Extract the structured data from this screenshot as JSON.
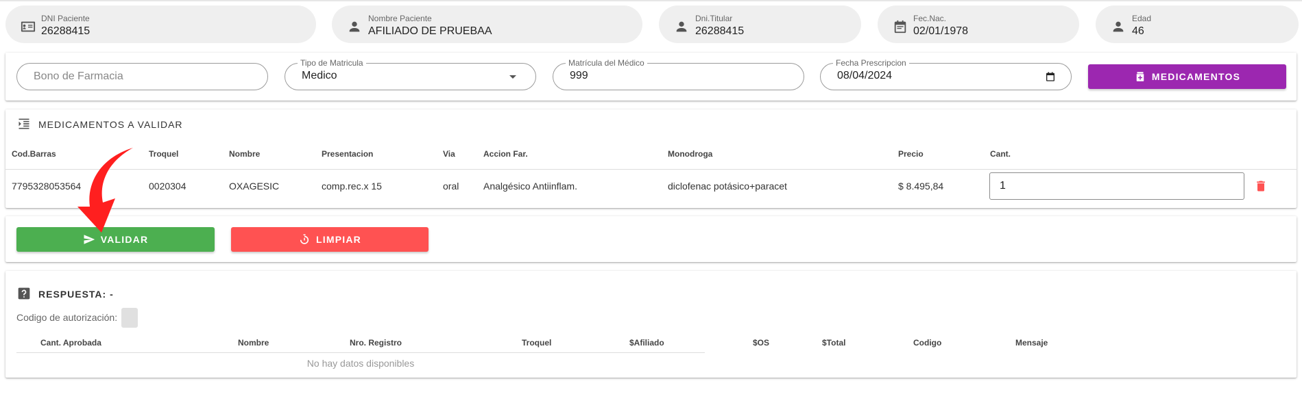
{
  "patient": {
    "dni": {
      "label": "DNI Paciente",
      "value": "26288415",
      "icon": "id-card-icon"
    },
    "nombre": {
      "label": "Nombre Paciente",
      "value": "AFILIADO DE PRUEBAA",
      "icon": "person-icon"
    },
    "titular": {
      "label": "Dni.Titular",
      "value": "26288415",
      "icon": "person-icon"
    },
    "fecnac": {
      "label": "Fec.Nac.",
      "value": "02/01/1978",
      "icon": "calendar-icon"
    },
    "edad": {
      "label": "Edad",
      "value": "46",
      "icon": "person-icon"
    }
  },
  "form": {
    "bono_placeholder": "Bono de Farmacia",
    "tipo_label": "Tipo de Matricula",
    "tipo_value": "Medico",
    "matricula_label": "Matrícula del Médico",
    "matricula_value": "999",
    "fecha_label": "Fecha Prescripcion",
    "fecha_value": "08/04/2024",
    "medicamentos_button": "MEDICAMENTOS"
  },
  "meds": {
    "title": "MEDICAMENTOS A VALIDAR",
    "columns": [
      "Cod.Barras",
      "Troquel",
      "Nombre",
      "Presentacion",
      "Via",
      "Accion Far.",
      "Monodroga",
      "Precio",
      "Cant."
    ],
    "rows": [
      {
        "cod_barras": "7795328053564",
        "troquel": "0020304",
        "nombre": "OXAGESIC",
        "presentacion": "comp.rec.x 15",
        "via": "oral",
        "accion": "Analgésico Antiinflam.",
        "monodroga": "diclofenac potásico+paracet",
        "precio": "$ 8.495,84",
        "cantidad": "1"
      }
    ]
  },
  "actions": {
    "validar": "VALIDAR",
    "limpiar": "LIMPIAR"
  },
  "respuesta": {
    "title": "RESPUESTA: -",
    "codigo_label": "Codigo de autorización:",
    "columns": [
      "Cant. Aprobada",
      "Nombre",
      "Nro. Registro",
      "Troquel",
      "$Afiliado",
      "$OS",
      "$Total",
      "Codigo",
      "Mensaje"
    ],
    "empty": "No hay datos disponibles"
  },
  "colors": {
    "primary_purple": "#9c27b0",
    "validar_green": "#4caf50",
    "limpiar_red": "#ff5252",
    "arrow_red": "#ff1f1f"
  }
}
